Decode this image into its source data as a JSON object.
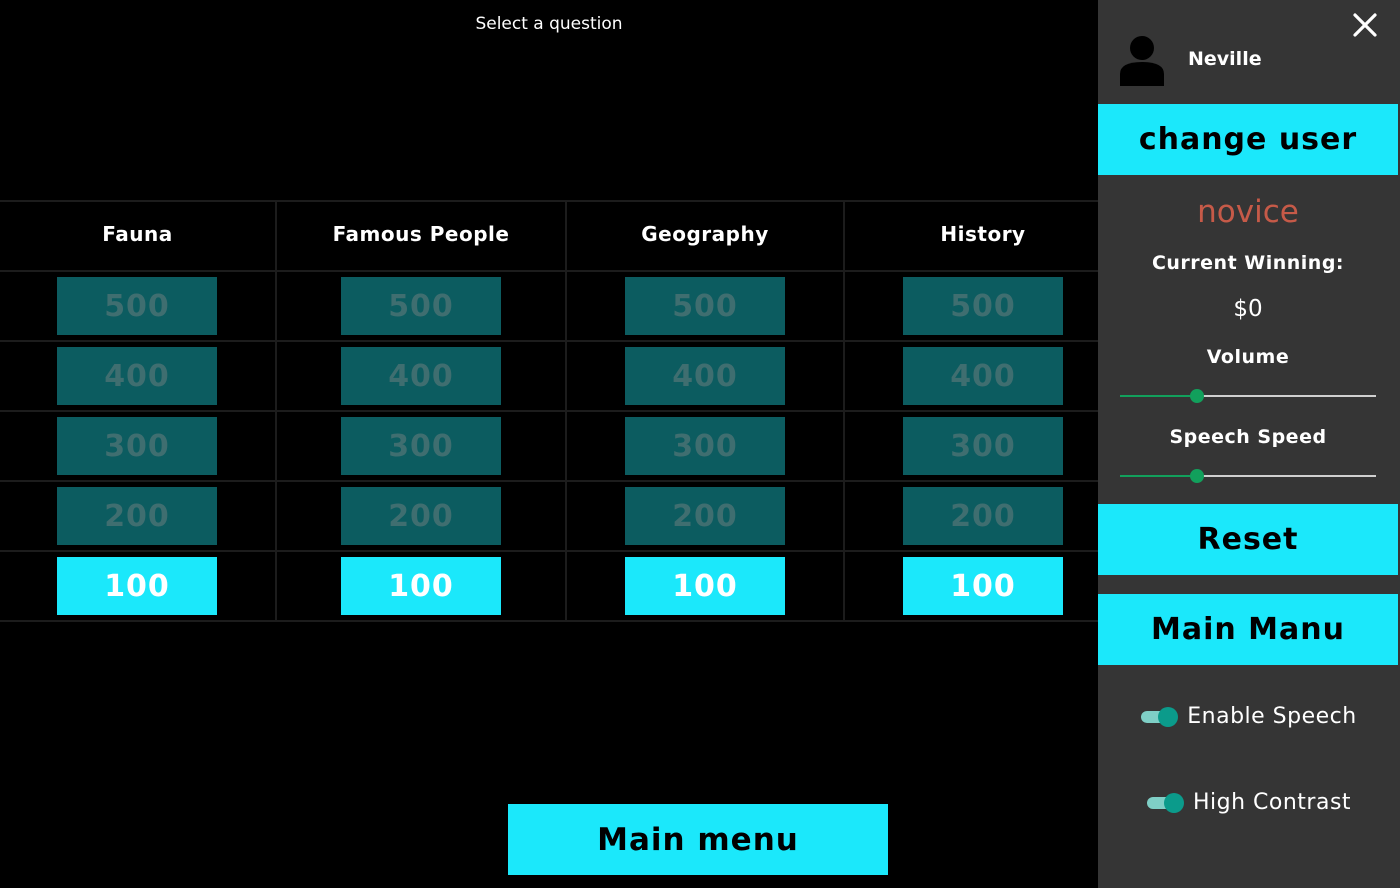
{
  "prompt": "Select a question",
  "board": {
    "categories": [
      {
        "title": "Fauna",
        "tiles": [
          "500",
          "400",
          "300",
          "200",
          "100"
        ]
      },
      {
        "title": "Famous People",
        "tiles": [
          "500",
          "400",
          "300",
          "200",
          "100"
        ]
      },
      {
        "title": "Geography",
        "tiles": [
          "500",
          "400",
          "300",
          "200",
          "100"
        ]
      },
      {
        "title": "History",
        "tiles": [
          "500",
          "400",
          "300",
          "200",
          "100"
        ]
      }
    ]
  },
  "footer": {
    "main_menu_label": "Main menu"
  },
  "sidebar": {
    "username": "Neville",
    "change_user_label": "change user",
    "level": "novice",
    "winnings_label": "Current Winning:",
    "winnings_value": "$0",
    "volume_label": "Volume",
    "volume_level": 0.3,
    "speech_speed_label": "Speech Speed",
    "speech_speed_level": 0.3,
    "reset_label": "Reset",
    "main_manu_label": "Main Manu",
    "enable_speech_label": "Enable Speech",
    "enable_speech_on": true,
    "high_contrast_label": "High Contrast",
    "high_contrast_on": true
  },
  "colors": {
    "accent": "#1be8fb",
    "tile_disabled": "#0c5c60",
    "level_text": "#c65a48",
    "slider": "#12a05c",
    "toggle": "#0b9b8b"
  },
  "icons": {
    "close": "close-icon",
    "avatar": "user-avatar-icon"
  }
}
